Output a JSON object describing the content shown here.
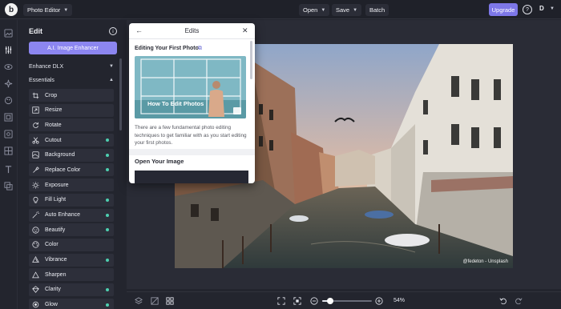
{
  "topbar": {
    "logo_letter": "b",
    "app_name": "Photo Editor",
    "open_label": "Open",
    "save_label": "Save",
    "batch_label": "Batch",
    "upgrade_label": "Upgrade",
    "help_symbol": "?",
    "avatar_letter": "D"
  },
  "panel": {
    "title": "Edit",
    "info_symbol": "i",
    "ai_button": "A.I. Image Enhancer",
    "section_enhance": "Enhance DLX",
    "section_essentials": "Essentials",
    "tools": [
      {
        "label": "Crop",
        "icon": "crop-icon",
        "dot": false
      },
      {
        "label": "Resize",
        "icon": "resize-icon",
        "dot": false
      },
      {
        "label": "Rotate",
        "icon": "rotate-icon",
        "dot": false
      },
      {
        "label": "Cutout",
        "icon": "scissors-icon",
        "dot": true
      },
      {
        "label": "Background",
        "icon": "background-icon",
        "dot": true
      },
      {
        "label": "Replace Color",
        "icon": "eyedropper-icon",
        "dot": true
      },
      {
        "label": "Exposure",
        "icon": "sun-icon",
        "dot": false
      },
      {
        "label": "Fill Light",
        "icon": "lightbulb-icon",
        "dot": true
      },
      {
        "label": "Auto Enhance",
        "icon": "magic-wand-icon",
        "dot": true
      },
      {
        "label": "Beautify",
        "icon": "face-icon",
        "dot": true
      },
      {
        "label": "Color",
        "icon": "palette-icon",
        "dot": false
      },
      {
        "label": "Vibrance",
        "icon": "vibrance-icon",
        "dot": true
      },
      {
        "label": "Sharpen",
        "icon": "triangle-icon",
        "dot": false
      },
      {
        "label": "Clarity",
        "icon": "diamond-icon",
        "dot": true
      },
      {
        "label": "Glow",
        "icon": "glow-icon",
        "dot": true
      }
    ]
  },
  "popup": {
    "back_symbol": "←",
    "title": "Edits",
    "close_symbol": "✕",
    "subtitle": "Editing Your First Photo",
    "link_symbol": "⧉",
    "video_caption": "How To Edit Photos",
    "body": "There are a few fundamental photo editing techniques to get familiar with as you start editing your first photos.",
    "heading2": "Open Your Image"
  },
  "canvas": {
    "credit": "@fedeton - Unsplash"
  },
  "bottombar": {
    "zoom_percent": "54%",
    "zoom_level": 0.54
  },
  "colors": {
    "accent": "#7d77e8",
    "ai_button": "#8c86f0",
    "dot": "#4ecfb0",
    "bg": "#23252e"
  }
}
